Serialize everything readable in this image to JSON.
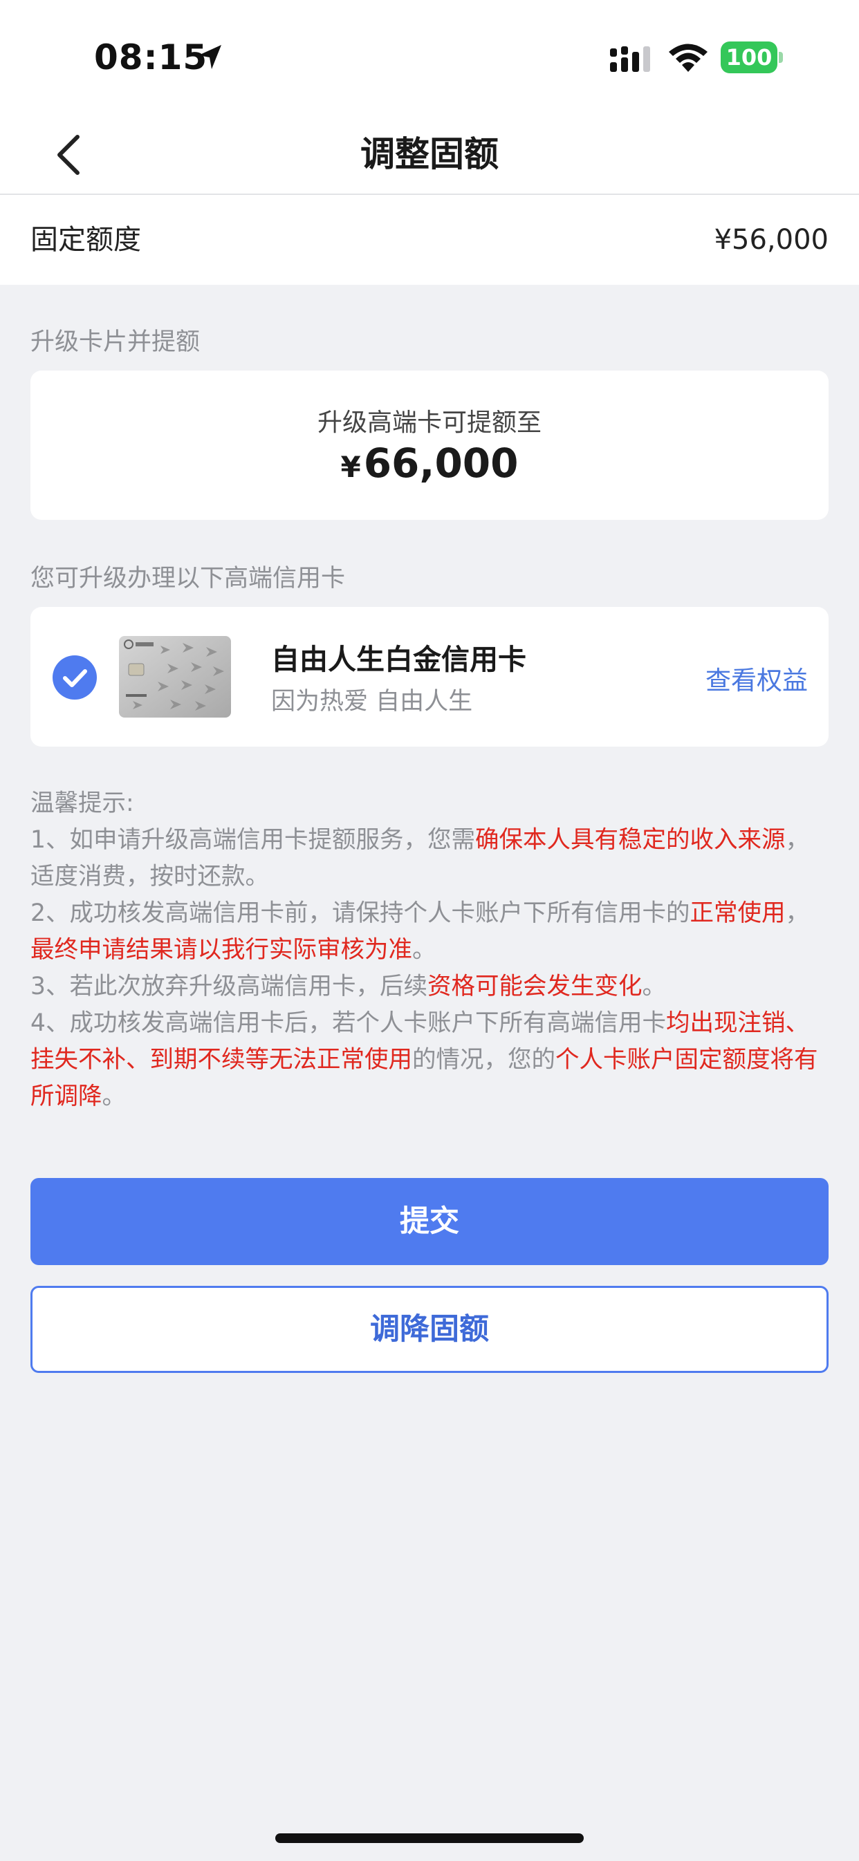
{
  "status_bar": {
    "time": "08:15",
    "battery": "100"
  },
  "nav": {
    "title": "调整固额"
  },
  "fixed_limit": {
    "label": "固定额度",
    "value": "¥56,000"
  },
  "upgrade_section": {
    "label": "升级卡片并提额",
    "subtitle": "升级高端卡可提额至",
    "currency": "¥",
    "amount": "66,000"
  },
  "card_section": {
    "label": "您可升级办理以下高端信用卡",
    "card": {
      "name": "自由人生白金信用卡",
      "desc": "因为热爱 自由人生",
      "link": "查看权益",
      "selected": true
    }
  },
  "tips": {
    "title": "温馨提示:",
    "t1a": "1、如申请升级高端信用卡提额服务，您需",
    "t1b": "确保本人具有稳定的收入来源",
    "t1c": "，适度消费，按时还款。",
    "t2a": "2、成功核发高端信用卡前，请保持个人卡账户下所有信用卡的",
    "t2b": "正常使用",
    "t2c": "，",
    "t2d": "最终申请结果请以我行实际审核为准",
    "t2e": "。",
    "t3a": "3、若此次放弃升级高端信用卡，后续",
    "t3b": "资格可能会发生变化",
    "t3c": "。",
    "t4a": "4、成功核发高端信用卡后，若个人卡账户下所有高端信用卡",
    "t4b": "均出现注销、挂失不补、到期不续等无法正常使用",
    "t4c": "的情况，您的",
    "t4d": "个人卡账户固定额度将有所调降",
    "t4e": "。"
  },
  "buttons": {
    "submit": "提交",
    "lower": "调降固额"
  },
  "colors": {
    "primary": "#4f7bef",
    "warning": "#e0281f",
    "muted": "#8e9095",
    "background": "#f0f1f4"
  },
  "icons": {
    "back": "chevron-left-icon",
    "check": "check-circle-icon",
    "location": "location-arrow-icon"
  }
}
